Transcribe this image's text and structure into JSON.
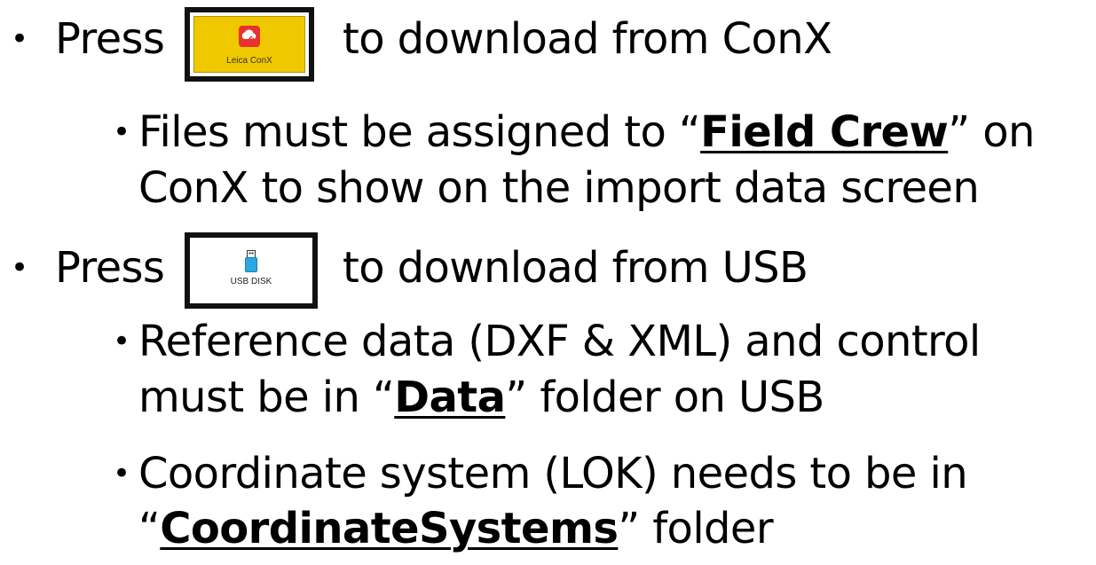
{
  "bullet_char": "•",
  "items": [
    {
      "press": "Press",
      "button_label": "Leica ConX",
      "button_icon": "leica-conx-cloud-icon",
      "rest": "to download from ConX",
      "sub": [
        {
          "line1_pre": "Files must be assigned to “",
          "line1_bold": "Field Crew",
          "line1_post": "” on",
          "line2": "ConX to show on the import data screen"
        }
      ]
    },
    {
      "press": "Press",
      "button_label": "USB DISK",
      "button_icon": "usb-drive-icon",
      "rest": "to download from USB",
      "sub": [
        {
          "line1": "Reference data (DXF & XML) and control",
          "line2_pre": "must be in “",
          "line2_bold": "Data",
          "line2_post": "” folder on USB"
        },
        {
          "line1": "Coordinate system (LOK) needs to be in",
          "line2_pre": "“",
          "line2_bold": "CoordinateSystems",
          "line2_post": "” folder"
        }
      ]
    }
  ],
  "colors": {
    "conx_button_bg": "#f0c800",
    "conx_logo_red": "#e8322f",
    "text": "#000000"
  }
}
